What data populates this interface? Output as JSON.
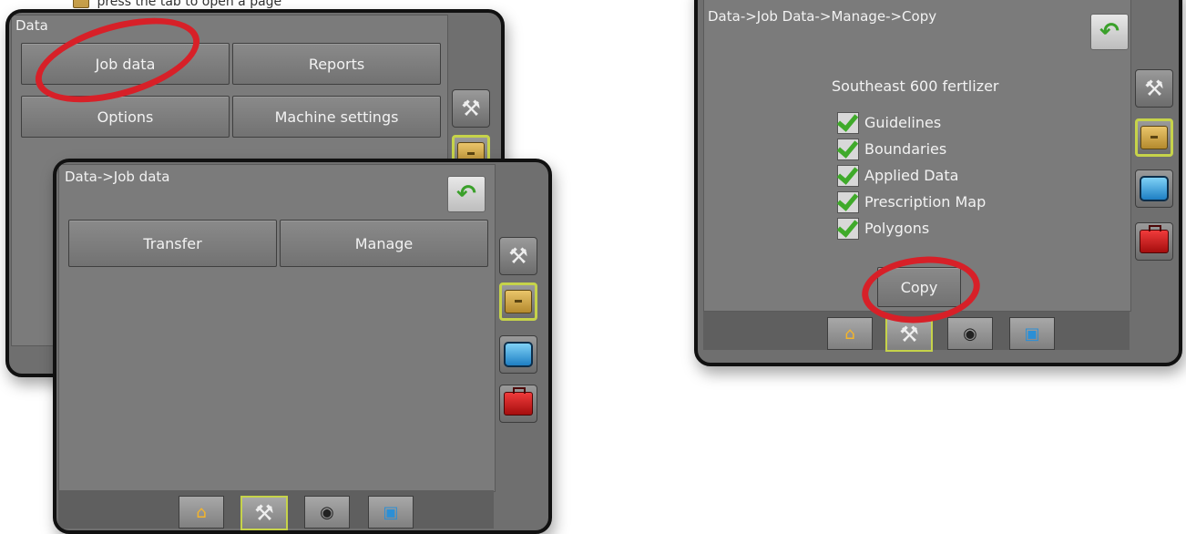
{
  "caption": {
    "text": "press the        tab to open a page"
  },
  "screen_data": {
    "title": "Data",
    "buttons": [
      "Job data",
      "Reports",
      "Options",
      "Machine settings"
    ]
  },
  "screen_jobdata": {
    "title": "Data->Job data",
    "buttons": [
      "Transfer",
      "Manage"
    ]
  },
  "screen_copy": {
    "title": "Data->Job Data->Manage->Copy",
    "job_name": "Southeast 600 fertlizer",
    "items": [
      "Guidelines",
      "Boundaries",
      "Applied Data",
      "Prescription Map",
      "Polygons"
    ],
    "copy_label": "Copy"
  },
  "icons": {
    "back": "back-arrow-icon",
    "tools": "tools-icon",
    "folder": "data-folder-icon",
    "monitor": "console-icon",
    "toolbox": "toolbox-icon",
    "home": "home-icon",
    "gps": "gps-icon",
    "network": "network-icon"
  },
  "colors": {
    "highlight": "#d72028",
    "selected_border": "#c6d34a",
    "back_arrow": "#3aa02a"
  }
}
